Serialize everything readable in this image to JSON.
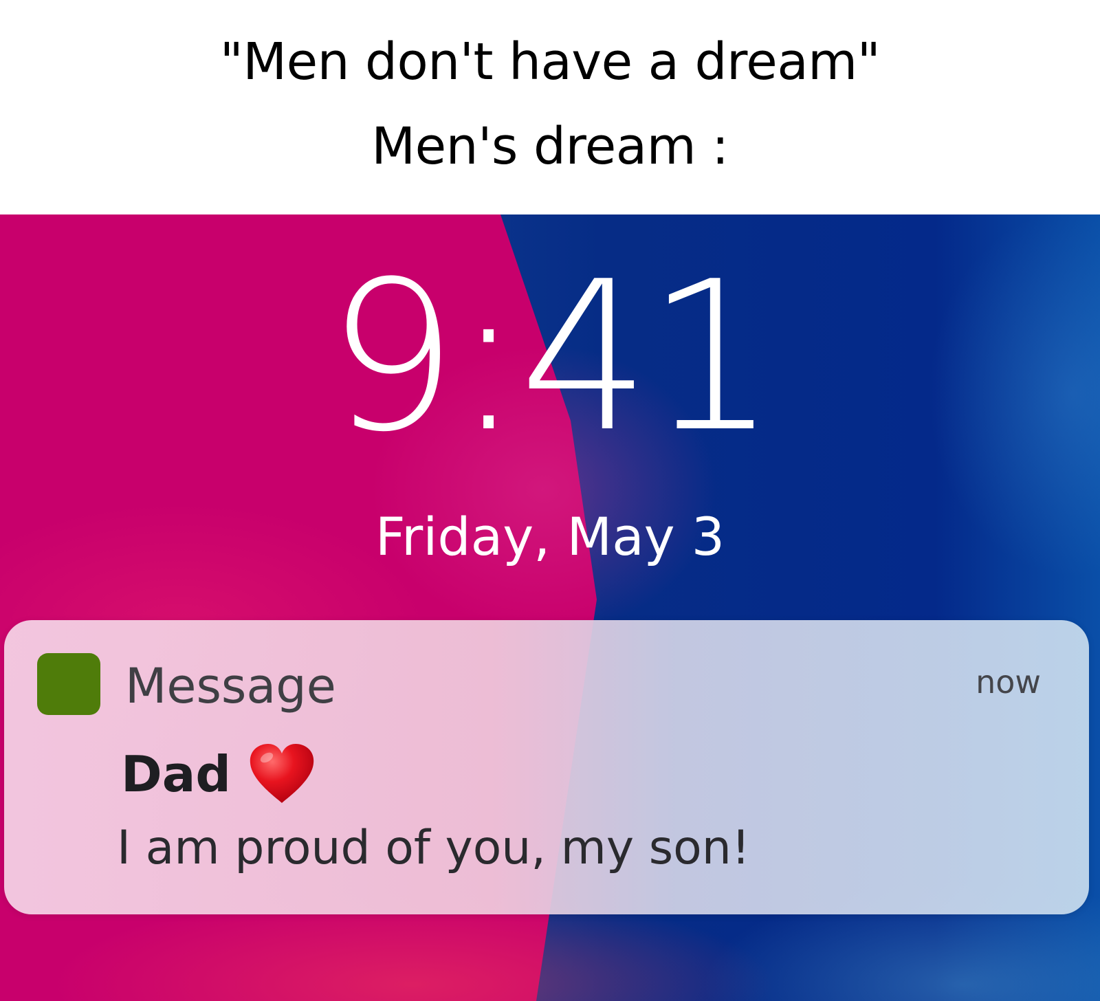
{
  "caption": {
    "line1": "\"Men don't have a dream\"",
    "line2": "Men's dream :"
  },
  "lockscreen": {
    "time": "9:41",
    "date": "Friday, May 3",
    "colors": {
      "wallpaper_pink": "#c8006c",
      "wallpaper_blue": "#062c86"
    }
  },
  "notification": {
    "app_name": "Message",
    "app_icon": "green-square-icon",
    "app_icon_color": "#4f7c0a",
    "timestamp": "now",
    "sender": "Dad",
    "sender_icon": "red-heart-icon",
    "body": "I am proud of you, my son!"
  }
}
